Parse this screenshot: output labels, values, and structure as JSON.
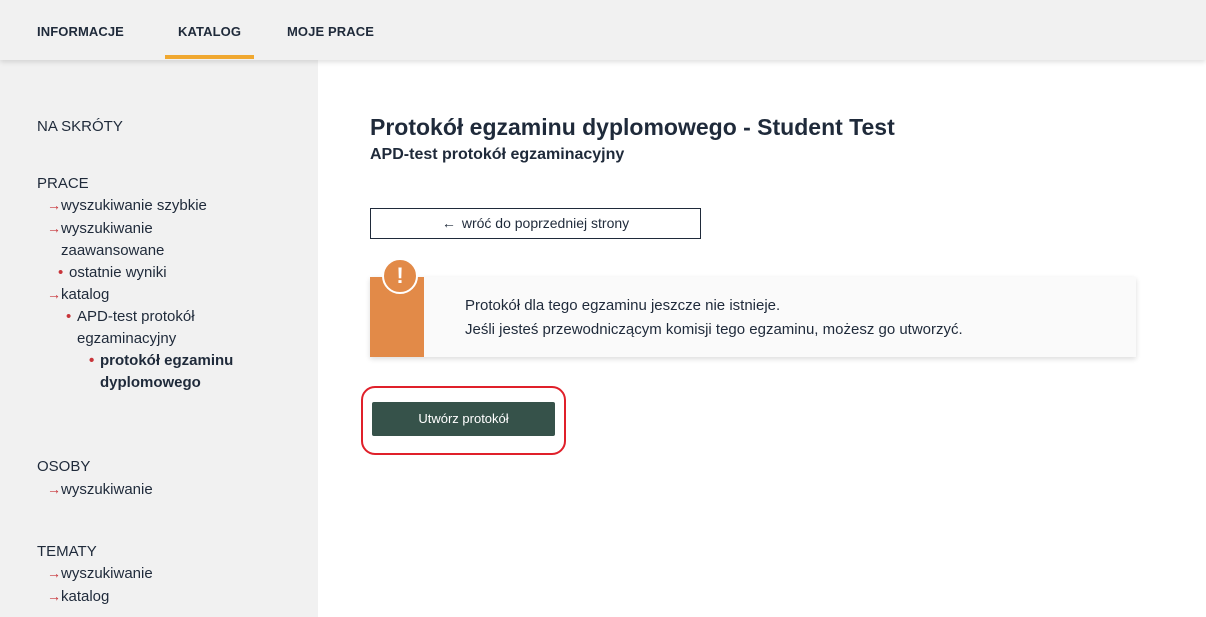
{
  "topnav": {
    "tabs": [
      {
        "label": "INFORMACJE"
      },
      {
        "label": "KATALOG",
        "active": true
      },
      {
        "label": "MOJE PRACE"
      }
    ],
    "accent_color": "#f0a830"
  },
  "sidebar": {
    "shortcuts_heading": "NA SKRÓTY",
    "prace_heading": "PRACE",
    "prace_items": [
      {
        "label": "wyszukiwanie szybkie"
      },
      {
        "label": "wyszukiwanie"
      },
      {
        "label": "zaawansowane"
      },
      {
        "label": "ostatnie wyniki"
      },
      {
        "label": "katalog"
      },
      {
        "label": "APD-test protokół"
      },
      {
        "label": "egzaminacyjny"
      },
      {
        "label": "protokół egzaminu"
      },
      {
        "label": "dyplomowego"
      }
    ],
    "osoby_heading": "OSOBY",
    "osoby_items": [
      {
        "label": "wyszukiwanie"
      }
    ],
    "tematy_heading": "TEMATY",
    "tematy_items": [
      {
        "label": "wyszukiwanie"
      },
      {
        "label": "katalog"
      }
    ],
    "marker_color": "#c8353a"
  },
  "main": {
    "title": "Protokół egzaminu dyplomowego - Student Test",
    "subtitle": "APD-test protokół egzaminacyjny",
    "back_button": {
      "arrow": "←",
      "label": "wróć do poprzedniej strony"
    },
    "notice": {
      "icon": "exclamation-icon",
      "line1": "Protokół dla tego egzaminu jeszcze nie istnieje.",
      "line2": "Jeśli jesteś przewodniczącym komisji tego egzaminu, możesz go utworzyć.",
      "color": "#e28a48"
    },
    "create_button": {
      "label": "Utwórz protokół",
      "color": "#36524a"
    },
    "highlight_color": "#e0202a"
  }
}
